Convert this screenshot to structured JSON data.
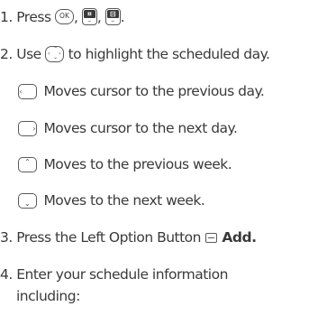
{
  "steps": {
    "s1": {
      "num": "1.",
      "text": "Press",
      "ok_label": "OK",
      "menu1_label": "⌗",
      "menu2_label": "⊟",
      "sep1": ",",
      "sep2": ",",
      "end": "."
    },
    "s2": {
      "num": "2.",
      "text_before": "Use",
      "text_after": "to highlight the scheduled day."
    },
    "keys": [
      {
        "glyph": "‹",
        "text": "Moves cursor to the previous day."
      },
      {
        "glyph": "›",
        "text": "Moves cursor to the next day."
      },
      {
        "glyph": "⌃",
        "text": "Moves to the previous week."
      },
      {
        "glyph": "⌄",
        "text": "Moves to the next week."
      }
    ],
    "s3": {
      "num": "3.",
      "text": "Press the Left Option Button",
      "action": "Add."
    },
    "s4": {
      "num": "4.",
      "line1": "Enter your schedule information",
      "line2": "including:"
    }
  }
}
